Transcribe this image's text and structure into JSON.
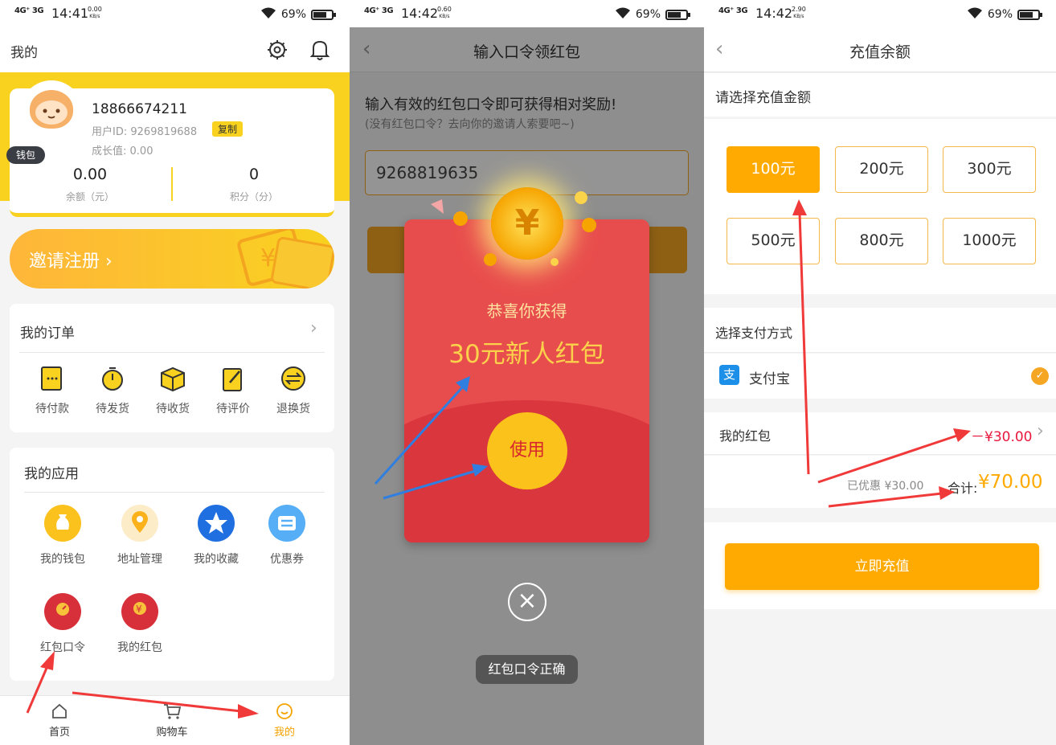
{
  "status_bars": [
    {
      "signal": "4G⁺ 3G",
      "time": "14:41",
      "speed": "0.00",
      "speed_unit": "KB/s",
      "battery": "69%"
    },
    {
      "signal": "4G⁺ 3G",
      "time": "14:42",
      "speed": "0.60",
      "speed_unit": "KB/s",
      "battery": "69%"
    },
    {
      "signal": "4G⁺ 3G",
      "time": "14:42",
      "speed": "2.90",
      "speed_unit": "KB/s",
      "battery": "69%"
    }
  ],
  "screen1": {
    "title": "我的",
    "phone": "18866674211",
    "user_id_label": "用户ID:",
    "user_id": "9269819688",
    "copy_label": "复制",
    "growth_label": "成长值:",
    "growth_value": "0.00",
    "wallet_tag": "钱包",
    "balance_value": "0.00",
    "balance_label": "余额（元）",
    "points_value": "0",
    "points_label": "积分（分）",
    "invite_label": "邀请注册 ›",
    "orders_title": "我的订单",
    "orders": [
      {
        "label": "待付款",
        "icon": "wallet-pending-icon"
      },
      {
        "label": "待发货",
        "icon": "stopwatch-icon"
      },
      {
        "label": "待收货",
        "icon": "package-icon"
      },
      {
        "label": "待评价",
        "icon": "clipboard-pen-icon"
      },
      {
        "label": "退换货",
        "icon": "exchange-icon"
      }
    ],
    "apps_title": "我的应用",
    "apps": [
      {
        "label": "我的钱包",
        "icon": "money-bag-icon"
      },
      {
        "label": "地址管理",
        "icon": "location-pin-icon"
      },
      {
        "label": "我的收藏",
        "icon": "star-icon"
      },
      {
        "label": "优惠券",
        "icon": "coupon-icon"
      },
      {
        "label": "红包口令",
        "icon": "red-packet-key-icon"
      },
      {
        "label": "我的红包",
        "icon": "red-packet-yen-icon"
      }
    ],
    "tabs": [
      "首页",
      "购物车",
      "我的"
    ],
    "colors": {
      "accent": "#f8d21f",
      "active_tab": "#f5a300",
      "arrow": "#f03a3a"
    }
  },
  "screen2": {
    "title": "输入口令领红包",
    "hint": "输入有效的红包口令即可获得相对奖励!",
    "subhint": "(没有红包口令？去向你的邀请人索要吧~)",
    "code_value": "9268819635",
    "congrats": "恭喜你获得",
    "prize": "30元新人红包",
    "use_label": "使用",
    "coin_symbol": "¥",
    "toast": "红包口令正确",
    "colors": {
      "packet": "#e84d4d",
      "prize": "#fbd04b",
      "arrow": "#2f7ee0"
    }
  },
  "screen3": {
    "title": "充值余额",
    "select_amount_label": "请选择充值金额",
    "amounts": [
      "100元",
      "200元",
      "300元",
      "500元",
      "800元",
      "1000元"
    ],
    "selected_amount": "100元",
    "pay_method_title": "选择支付方式",
    "alipay_label": "支付宝",
    "alipay_icon": "支",
    "red_packet_label": "我的红包",
    "red_packet_value": "－¥30.00",
    "discount_label": "已优惠 ¥30.00",
    "total_label": "合计:",
    "total_value": "¥70.00",
    "recharge_button": "立即充值",
    "colors": {
      "accent": "#ffaa00",
      "discount": "#e8183c"
    }
  }
}
